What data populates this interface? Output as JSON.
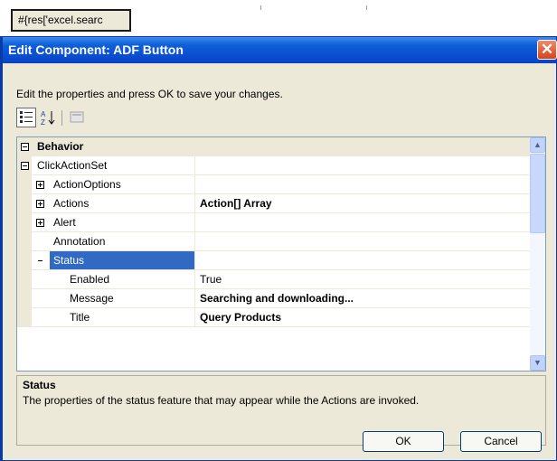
{
  "background": {
    "tab_label": "#{res['excel.searc"
  },
  "dialog": {
    "title": "Edit Component: ADF Button",
    "close_symbol": "✕",
    "instructions": "Edit the properties and press OK to save your changes."
  },
  "toolbar": {
    "categorized_icon": "categorized-icon",
    "alphabetical_icon": "alphabetical-sort-icon",
    "alphabetical_label": "A↓",
    "pages_icon": "property-pages-icon"
  },
  "grid": {
    "category": "Behavior",
    "rows": [
      {
        "name": "ClickActionSet",
        "value": ""
      },
      {
        "name": "ActionOptions",
        "value": ""
      },
      {
        "name": "Actions",
        "value": "Action[] Array"
      },
      {
        "name": "Alert",
        "value": ""
      },
      {
        "name": "Annotation",
        "value": ""
      },
      {
        "name": "Status",
        "value": ""
      },
      {
        "name": "Enabled",
        "value": "True"
      },
      {
        "name": "Message",
        "value": "Searching and downloading..."
      },
      {
        "name": "Title",
        "value": "Query Products"
      }
    ]
  },
  "description": {
    "title": "Status",
    "text": "The properties of the status feature that may appear while the Actions are invoked."
  },
  "buttons": {
    "ok": "OK",
    "cancel": "Cancel"
  },
  "colors": {
    "titlebar": "#0a4fd0",
    "selection": "#316ac5",
    "dialog_bg": "#ece9d8"
  }
}
